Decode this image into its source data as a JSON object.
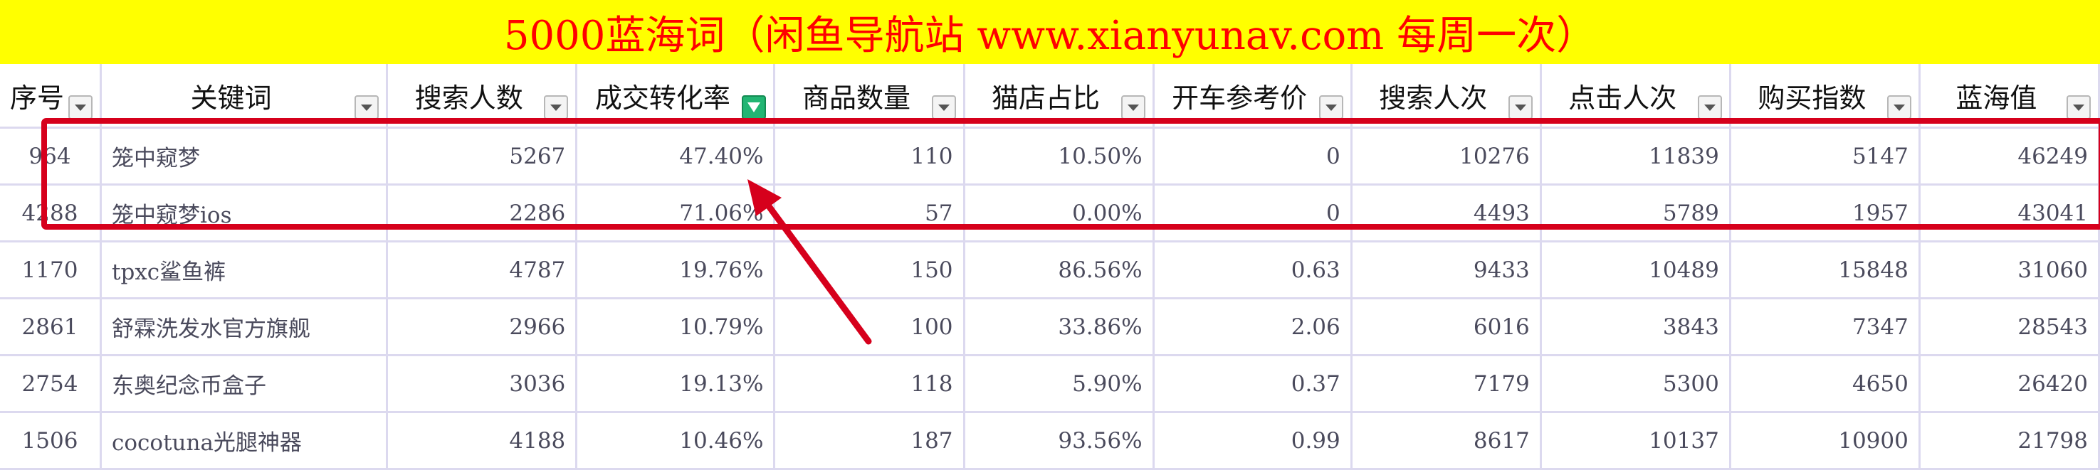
{
  "title": "5000蓝海词（闲鱼导航站 www.xianyunav.com  每周一次）",
  "colors": {
    "title_bg": "#ffff00",
    "title_text": "#ff0000",
    "highlight": "#d6001c",
    "filter_active": "#22b573"
  },
  "headers": [
    "序号",
    "关键词",
    "搜索人数",
    "成交转化率",
    "商品数量",
    "猫店占比",
    "开车参考价",
    "搜索人次",
    "点击人次",
    "购买指数",
    "蓝海值"
  ],
  "active_filter_column": "成交转化率",
  "rows": [
    [
      "964",
      "笼中窥梦",
      "5267",
      "47.40%",
      "110",
      "10.50%",
      "0",
      "10276",
      "11839",
      "5147",
      "46249"
    ],
    [
      "4288",
      "笼中窥梦ios",
      "2286",
      "71.06%",
      "57",
      "0.00%",
      "0",
      "4493",
      "5789",
      "1957",
      "43041"
    ],
    [
      "1170",
      "tpxc鲨鱼裤",
      "4787",
      "19.76%",
      "150",
      "86.56%",
      "0.63",
      "9433",
      "10489",
      "15848",
      "31060"
    ],
    [
      "2861",
      "舒霖洗发水官方旗舰",
      "2966",
      "10.79%",
      "100",
      "33.86%",
      "2.06",
      "6016",
      "3843",
      "7347",
      "28543"
    ],
    [
      "2754",
      "东奥纪念币盒子",
      "3036",
      "19.13%",
      "118",
      "5.90%",
      "0.37",
      "7179",
      "5300",
      "4650",
      "26420"
    ],
    [
      "1506",
      "cocotuna光腿神器",
      "4188",
      "10.46%",
      "187",
      "93.56%",
      "0.99",
      "8617",
      "10137",
      "10900",
      "21798"
    ]
  ]
}
